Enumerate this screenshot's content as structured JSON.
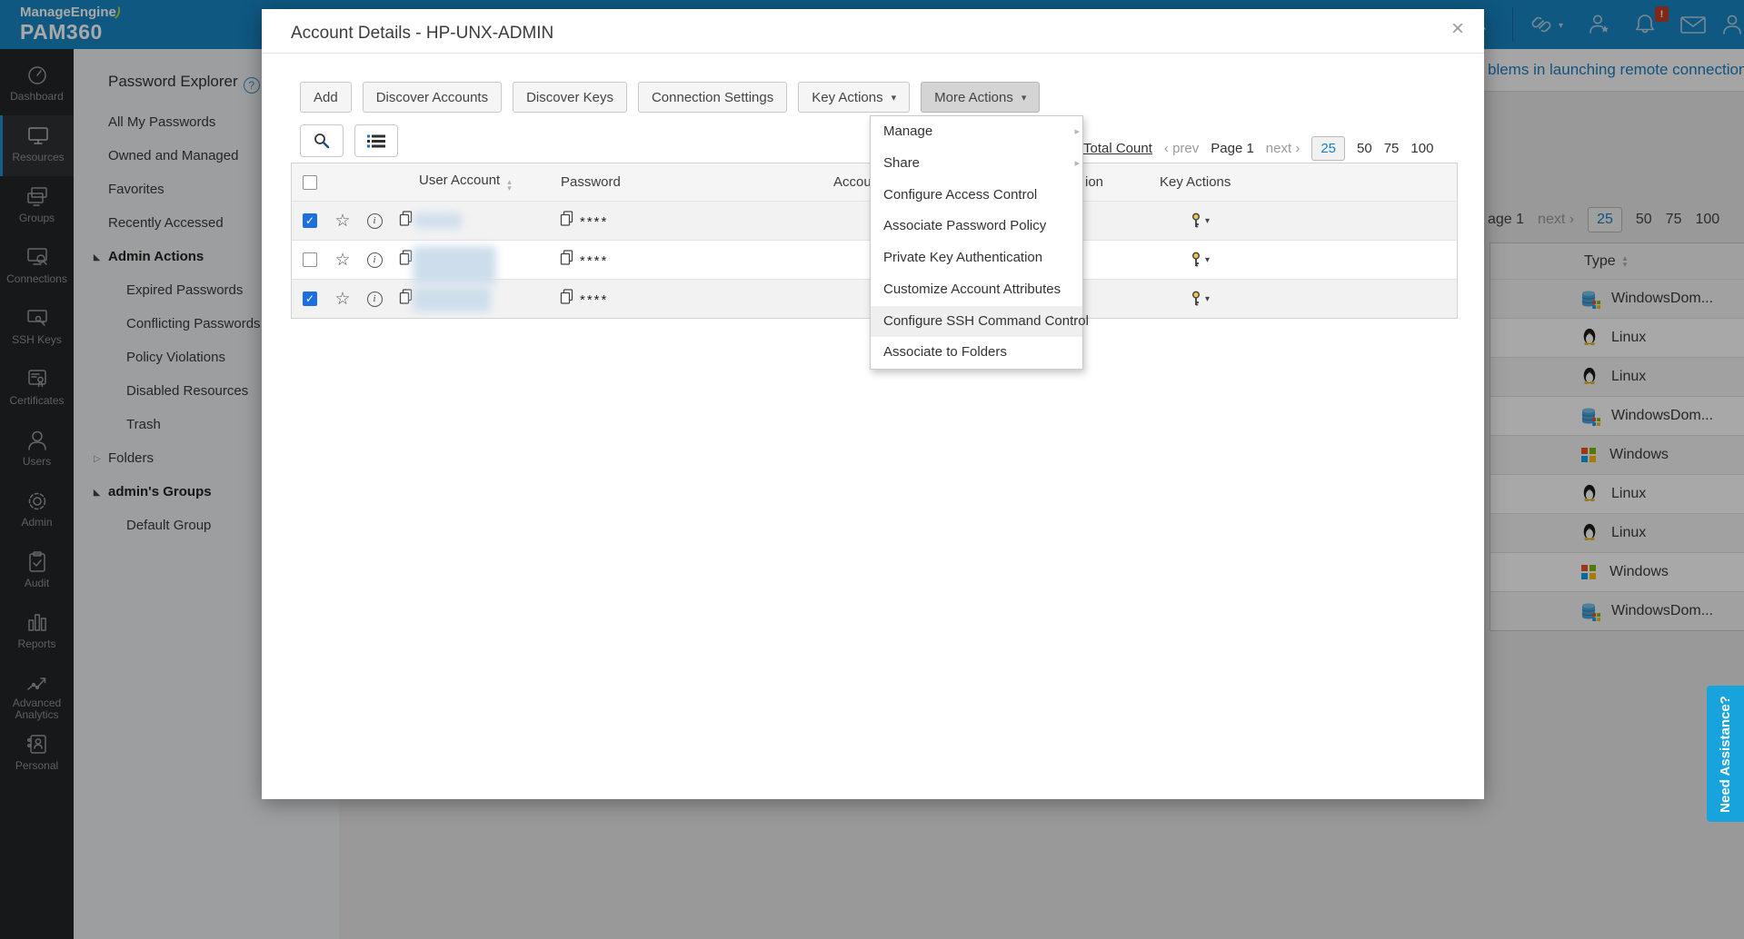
{
  "brand": {
    "company": "ManageEngine",
    "swoosh": ")",
    "product": "PAM360"
  },
  "icons": {
    "close": "×",
    "star": "☆",
    "info": "i",
    "help": "?",
    "check": "✓",
    "caret_down": "▾",
    "submenu_caret": "▸",
    "sort_up": "▴",
    "sort_down": "▾",
    "prev_chev": "‹",
    "next_chev": "›",
    "tri_expanded": "◣",
    "tri_collapsed": "▷"
  },
  "topbar": {
    "icons": [
      {
        "name": "rocket-icon"
      },
      {
        "name": "link-icon"
      },
      {
        "name": "user-star-icon"
      },
      {
        "name": "bell-icon",
        "badge": "!"
      },
      {
        "name": "mail-icon"
      },
      {
        "name": "user-icon"
      }
    ]
  },
  "sidebar": {
    "items": [
      {
        "label": "Dashboard"
      },
      {
        "label": "Resources",
        "active": true
      },
      {
        "label": "Groups"
      },
      {
        "label": "Connections"
      },
      {
        "label": "SSH Keys"
      },
      {
        "label": "Certificates"
      },
      {
        "label": "Users"
      },
      {
        "label": "Admin"
      },
      {
        "label": "Audit"
      },
      {
        "label": "Reports"
      },
      {
        "label": "Advanced Analytics"
      },
      {
        "label": "Personal"
      }
    ]
  },
  "explorer": {
    "title": "Password Explorer",
    "items": [
      {
        "label": "All My Passwords"
      },
      {
        "label": "Owned and Managed"
      },
      {
        "label": "Favorites"
      },
      {
        "label": "Recently Accessed"
      },
      {
        "label": "Admin Actions",
        "bold": true,
        "state": "expanded"
      },
      {
        "label": "Expired Passwords",
        "indent": true
      },
      {
        "label": "Conflicting Passwords",
        "indent": true
      },
      {
        "label": "Policy Violations",
        "indent": true
      },
      {
        "label": "Disabled Resources",
        "indent": true
      },
      {
        "label": "Trash",
        "indent": true
      },
      {
        "label": "Folders",
        "state": "collapsed"
      },
      {
        "label": "admin's Groups",
        "bold": true,
        "state": "expanded"
      },
      {
        "label": "Default Group",
        "indent": true
      }
    ]
  },
  "modal": {
    "title": "Account Details - HP-UNX-ADMIN",
    "toolbar": [
      "Add",
      "Discover Accounts",
      "Discover Keys",
      "Connection Settings",
      "Key Actions",
      "More Actions"
    ],
    "pagination": {
      "total_count": "Total Count",
      "prev": "prev",
      "page": "Page 1",
      "next": "next",
      "sizes": [
        "25",
        "50",
        "75",
        "100"
      ],
      "selected_size": "25"
    },
    "table": {
      "headers": {
        "user_account": "User Account",
        "password": "Password",
        "account_fragment": "Accou",
        "ion_fragment": "ion",
        "key_actions": "Key Actions"
      },
      "rows": [
        {
          "checked": true,
          "user_account": "",
          "password_mask": "****"
        },
        {
          "checked": false,
          "user_account": "",
          "password_mask": "****"
        },
        {
          "checked": true,
          "user_account": "",
          "password_mask": "****"
        }
      ]
    }
  },
  "dropdown": {
    "items": [
      {
        "label": "Manage",
        "submenu": true
      },
      {
        "label": "Share",
        "submenu": true
      },
      {
        "label": "Configure Access Control"
      },
      {
        "label": "Associate Password Policy"
      },
      {
        "label": "Private Key Authentication"
      },
      {
        "label": "Customize Account Attributes"
      },
      {
        "label": "Configure SSH Command Control",
        "highlighted": true
      },
      {
        "label": "Associate to Folders"
      }
    ]
  },
  "background": {
    "remote_link": "blems in launching remote connections?",
    "pagination": {
      "page_fragment": "age 1",
      "next": "next",
      "sizes": [
        "25",
        "50",
        "75",
        "100"
      ],
      "selected_size": "25"
    },
    "table": {
      "type_header": "Type",
      "rows": [
        {
          "type": "WindowsDom...",
          "os": "windows-domain"
        },
        {
          "type": "Linux",
          "os": "linux"
        },
        {
          "type": "Linux",
          "os": "linux"
        },
        {
          "type": "WindowsDom...",
          "os": "windows-domain"
        },
        {
          "type": "Windows",
          "os": "windows"
        },
        {
          "type": "Linux",
          "os": "linux"
        },
        {
          "type": "Linux",
          "os": "linux"
        },
        {
          "type": "Windows",
          "os": "windows"
        },
        {
          "type": "WindowsDom...",
          "os": "windows-domain"
        }
      ]
    }
  },
  "need_assistance": {
    "label": "Need Assistance?"
  },
  "colors": {
    "topbar": "#1786c5",
    "accent_blue": "#1a7dc0",
    "need_tab": "#18a3dd",
    "sidebar_dark": "#232527",
    "checked_checkbox": "#1d6fe0",
    "badge_red": "#c63a24"
  }
}
